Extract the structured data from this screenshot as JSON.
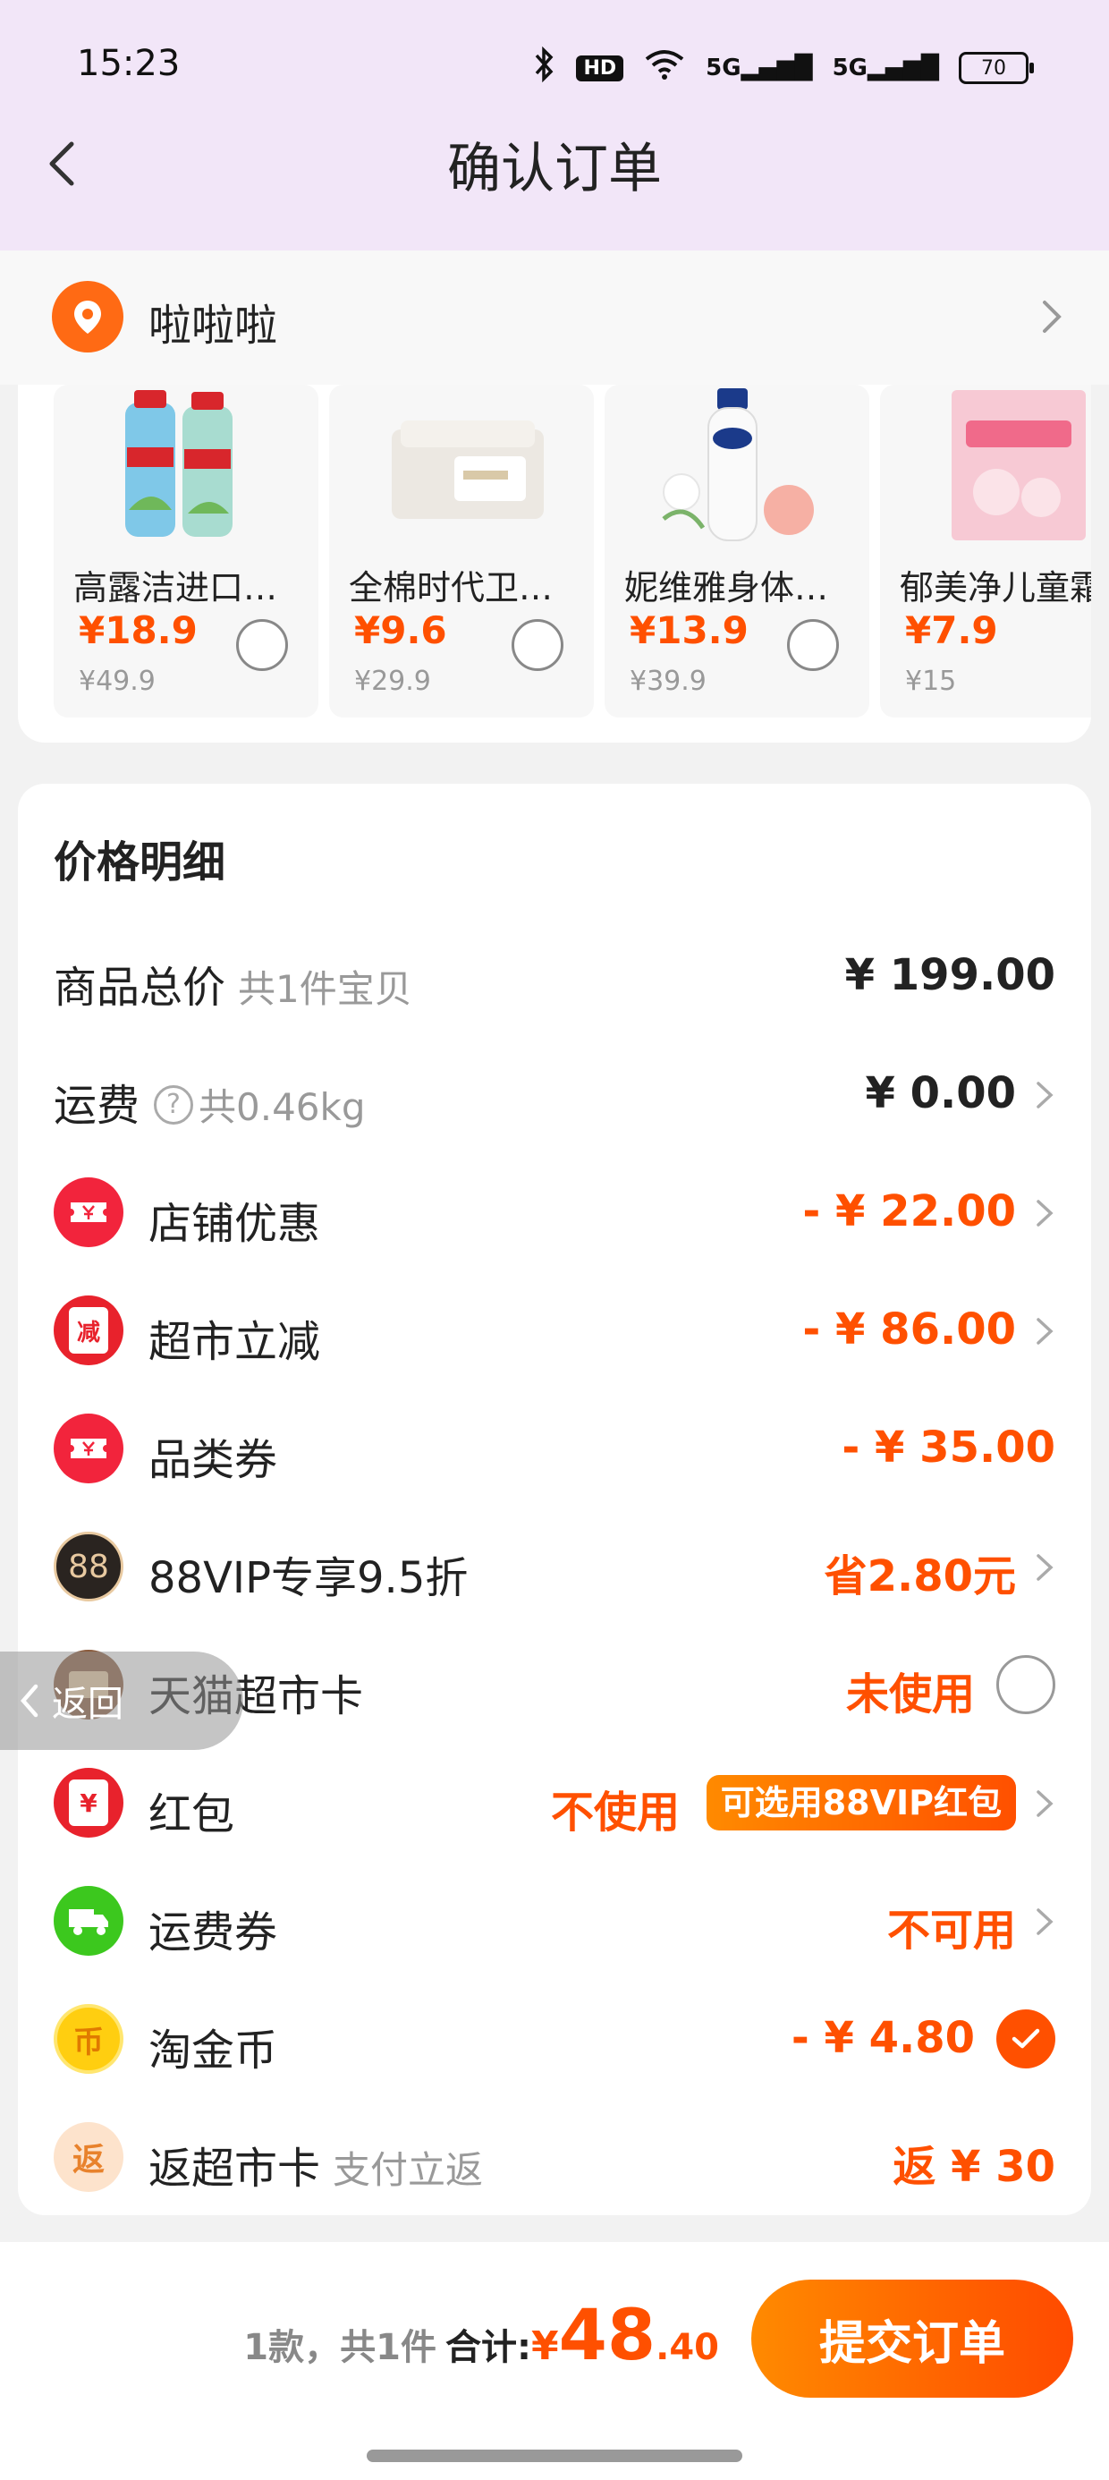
{
  "status_bar": {
    "time": "15:23",
    "hd": "HD",
    "sig1": "5G",
    "sig2": "5G",
    "battery": "70"
  },
  "nav": {
    "title": "确认订单"
  },
  "address": {
    "name": "啦啦啦"
  },
  "products": [
    {
      "name": "高露洁进口抑菌漱口水",
      "price": "¥18.9",
      "original": "¥49.9"
    },
    {
      "name": "全棉时代卫生巾",
      "price": "¥9.6",
      "original": "¥29.9"
    },
    {
      "name": "妮维雅身体乳液",
      "price": "¥13.9",
      "original": "¥39.9"
    },
    {
      "name": "郁美净儿童霜",
      "price": "¥7.9",
      "original": "¥15"
    }
  ],
  "price_detail": {
    "title": "价格明细",
    "goods_total_label": "商品总价",
    "goods_total_sub": "共1件宝贝",
    "goods_total_value": "¥ 199.00",
    "shipping_label": "运费",
    "shipping_help": "?",
    "shipping_sub": "共0.46kg",
    "shipping_value": "¥ 0.00",
    "shop_discount_label": "店铺优惠",
    "shop_discount_value": "- ¥ 22.00",
    "market_cut_label": "超市立减",
    "market_cut_icon": "减",
    "market_cut_value": "- ¥ 86.00",
    "category_coupon_label": "品类券",
    "category_coupon_value": "- ¥ 35.00",
    "vip_label": "88VIP专享9.5折",
    "vip_icon": "88",
    "vip_value": "省2.80元",
    "tmall_card_label": "天猫超市卡",
    "tmall_card_value": "未使用",
    "red_packet_label": "红包",
    "red_packet_icon": "¥",
    "red_packet_value": "不使用",
    "red_packet_pill": "可选用88VIP红包",
    "shipping_coupon_label": "运费券",
    "shipping_coupon_value": "不可用",
    "taojin_label": "淘金币",
    "taojin_icon": "币",
    "taojin_value": "- ¥ 4.80",
    "rebate_label": "返超市卡",
    "rebate_icon": "返",
    "rebate_sub": "支付立返",
    "rebate_value": "返 ¥ 30"
  },
  "float_back": {
    "label": "返回"
  },
  "bottom": {
    "count_text": "1款，共1件",
    "total_label": "合计:",
    "yen": "¥",
    "total_int": "48",
    "total_dec": ".40",
    "submit_label": "提交订单"
  },
  "colors": {
    "accent": "#ff5000",
    "header_bg": "#f2e6f8"
  }
}
